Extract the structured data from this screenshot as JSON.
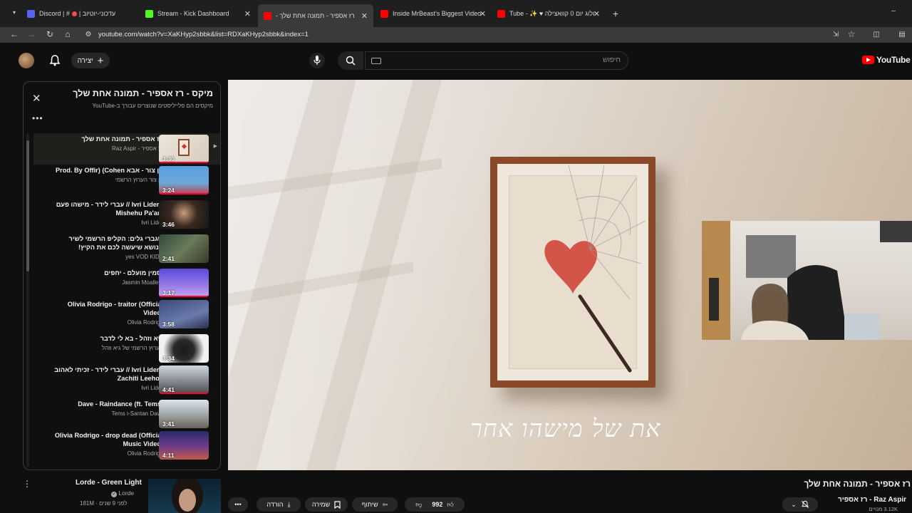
{
  "browser": {
    "tabs": [
      {
        "label": "Discord | #",
        "extra": "| עדכוני-יוטיוב",
        "favicon_color": "#5865F2",
        "active": false
      },
      {
        "label": "Stream - Kick Dashboard",
        "favicon_color": "#53FC18",
        "active": false
      },
      {
        "label": "רז אספיר - תמונה אחת שלך -",
        "favicon_color": "#FF0000",
        "active": true
      },
      {
        "label": "Inside MrBeast's Biggest Video",
        "favicon_color": "#FF0000",
        "active": false
      },
      {
        "label": "ולוג יום 0 קוואצילה ♥ ✨ - Tube",
        "favicon_color": "#FF0000",
        "active": false
      }
    ],
    "url": "youtube.com/watch?v=XaKHyp2sbbk&list=RDXaKHyp2sbbk&index=1"
  },
  "header": {
    "create_label": "יצירה",
    "search_placeholder": "חיפוש",
    "logo_text": "YouTube"
  },
  "playlist": {
    "title": "מיקס - רז אספיר - תמונה אחת שלך",
    "subtitle": "מיקסים הם פלייליסטים שנוצרים עבורך ב-YouTube",
    "items": [
      {
        "title": "רז אספיר - תמונה אחת שלך",
        "channel": "Raz Aspir - רז אספיר",
        "duration": "3:30",
        "current": true
      },
      {
        "title": "בן צור - אבא Prod. By Offir) (Cohen",
        "channel": "בן צור הערוץ הרשמי",
        "duration": "3:24"
      },
      {
        "title": "עברי לידר - מישהו פעם // Ivri Lider - Mishehu Pa'am",
        "channel": "Ivri Lider",
        "duration": "3:46"
      },
      {
        "title": "שגברי גלים: הקליפ הרשמי לשיר הנושא שיעשה לכם את הקיץ!",
        "channel": "yes VOD KIDS",
        "duration": "2:41"
      },
      {
        "title": "יסמין מועלם - יחפים",
        "channel": "Jasmin Moallem",
        "duration": "3:17"
      },
      {
        "title": "Olivia Rodrigo - traitor (Official Video)",
        "channel": "Olivia Rodrigo",
        "duration": "3:58"
      },
      {
        "title": "גיא וזהל - בא לי לדבר",
        "channel": "הערוץ הרשמי של גיא וזהל",
        "duration": "3:34"
      },
      {
        "title": "עברי לידר - זכיתי לאהוב // Ivri Lider - Zachiti Leehov",
        "channel": "Ivri Lider",
        "duration": "4:41"
      },
      {
        "title": "Dave - Raindance (ft. Tems)",
        "channel": "Tems ו-Santan Dave",
        "duration": "3:41"
      },
      {
        "title": "Olivia Rodrigo - drop dead (Official Music Video)",
        "channel": "Olivia Rodrigo",
        "duration": "4:11"
      }
    ]
  },
  "video": {
    "lyric_overlay": "את של מישהו אחר",
    "title": "רז אספיר - תמונה אחת שלך",
    "channel": "Raz Aspir - רז אספיר",
    "subscribers": "3.12K מנויים",
    "likes": "992",
    "share_label": "שיתוף",
    "save_label": "שמירה",
    "download_label": "הורדה"
  },
  "related": {
    "title": "Lorde - Green Light",
    "channel": "Lorde",
    "meta": "181M · לפני 9 שנים"
  },
  "colors": {
    "background": "#0f0f0f",
    "accent_red": "#ff0033",
    "pill": "#272727"
  }
}
